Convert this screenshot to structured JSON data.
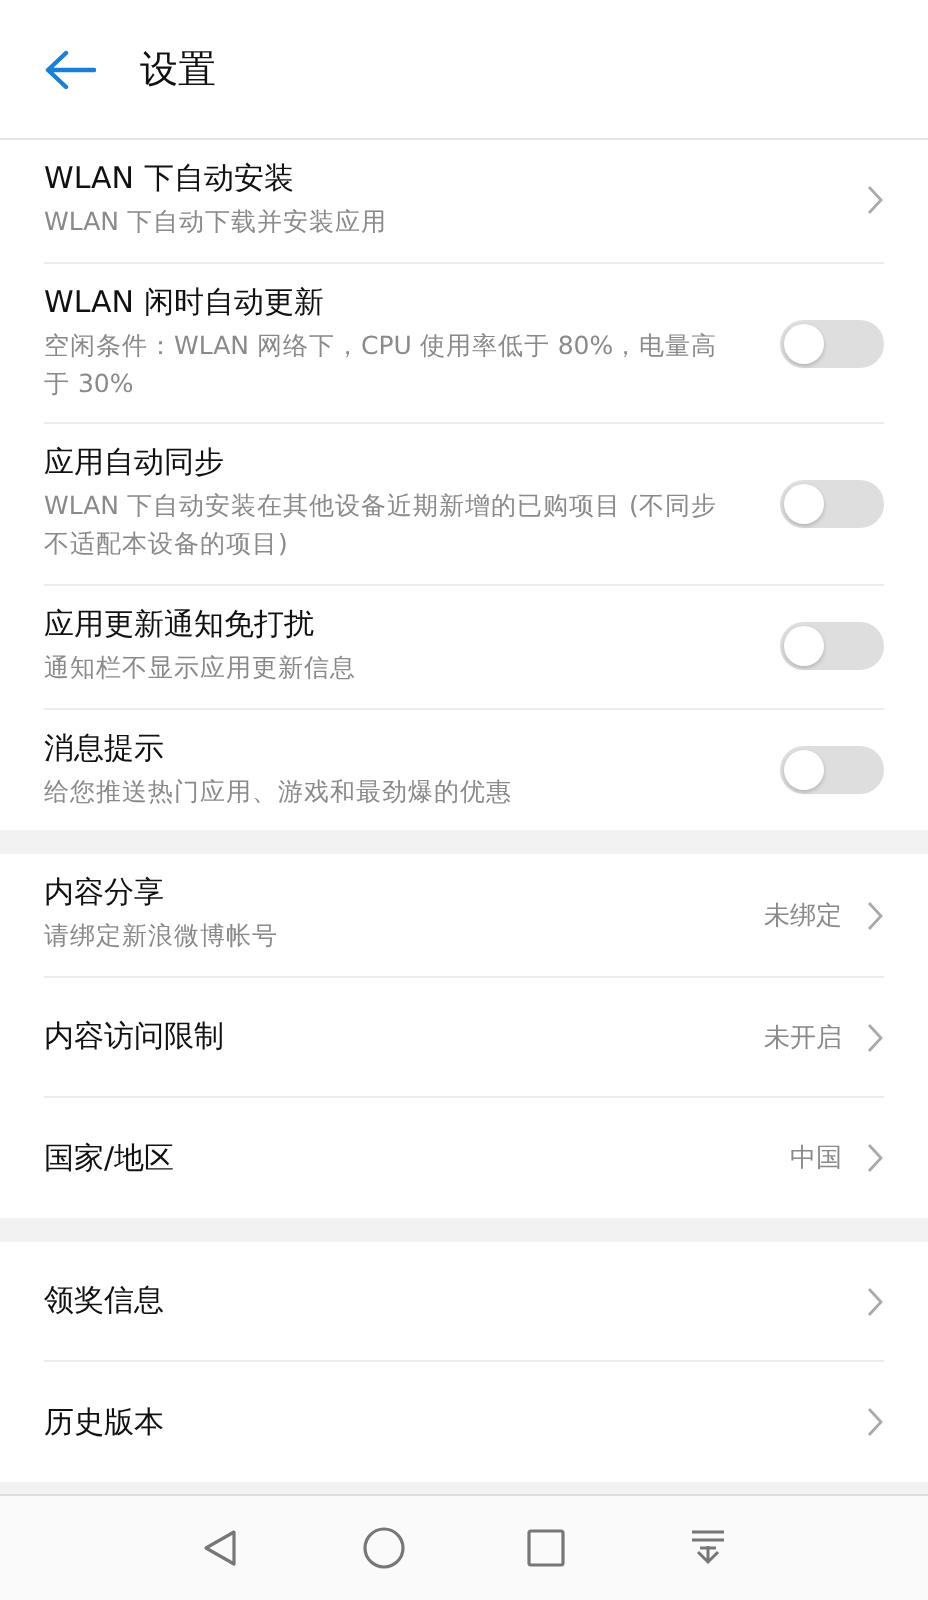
{
  "header": {
    "title": "设置"
  },
  "groups": [
    {
      "items": [
        {
          "kind": "link",
          "title": "WLAN 下自动安装",
          "subtitle": "WLAN 下自动下载并安装应用"
        },
        {
          "kind": "toggle",
          "title": "WLAN 闲时自动更新",
          "subtitle": "空闲条件：WLAN 网络下，CPU 使用率低于 80%，电量高于 30%",
          "on": false
        },
        {
          "kind": "toggle",
          "title": "应用自动同步",
          "subtitle": "WLAN 下自动安装在其他设备近期新增的已购项目 (不同步不适配本设备的项目)",
          "on": false
        },
        {
          "kind": "toggle",
          "title": "应用更新通知免打扰",
          "subtitle": "通知栏不显示应用更新信息",
          "on": false
        },
        {
          "kind": "toggle",
          "title": "消息提示",
          "subtitle": "给您推送热门应用、游戏和最劲爆的优惠",
          "on": false
        }
      ]
    },
    {
      "items": [
        {
          "kind": "link",
          "title": "内容分享",
          "subtitle": "请绑定新浪微博帐号",
          "value": "未绑定"
        },
        {
          "kind": "link",
          "title": "内容访问限制",
          "value": "未开启"
        },
        {
          "kind": "link",
          "title": "国家/地区",
          "value": "中国"
        }
      ]
    },
    {
      "items": [
        {
          "kind": "link",
          "title": "领奖信息"
        },
        {
          "kind": "link",
          "title": "历史版本"
        }
      ]
    }
  ]
}
